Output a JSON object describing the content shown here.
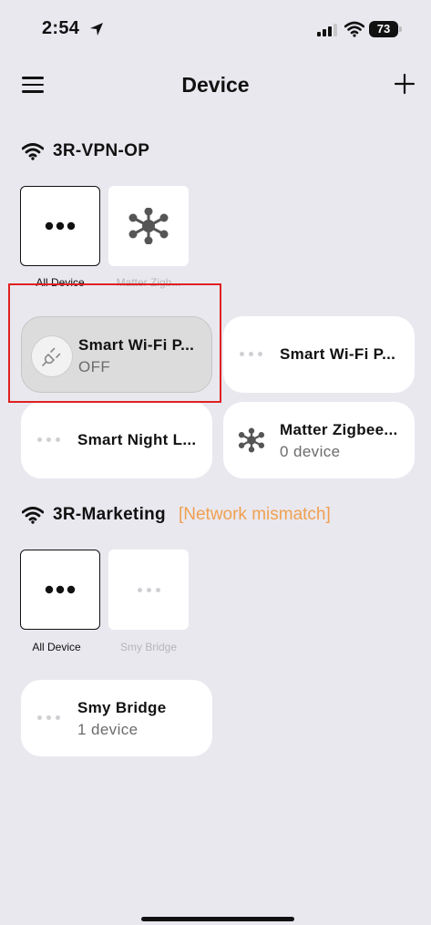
{
  "status_bar": {
    "time": "2:54",
    "battery": "73"
  },
  "nav": {
    "title": "Device"
  },
  "networks": [
    {
      "name": "3R-VPN-OP",
      "warning": "",
      "tiles": [
        {
          "label": "All Device",
          "icon": "more-dots-icon",
          "selected": true
        },
        {
          "label": "Matter Zigb...",
          "icon": "hub-icon",
          "selected": false
        }
      ],
      "devices": [
        {
          "title": "Smart Wi-Fi P...",
          "subtitle": "OFF",
          "icon": "plug-icon",
          "active": true
        },
        {
          "title": "Smart Wi-Fi P...",
          "subtitle": "",
          "icon": "faint-dots-icon",
          "active": false
        },
        {
          "title": "Smart Night L...",
          "subtitle": "",
          "icon": "faint-dots-icon",
          "active": false
        },
        {
          "title": "Matter Zigbee...",
          "subtitle": "0 device",
          "icon": "hub-icon",
          "active": false
        }
      ]
    },
    {
      "name": "3R-Marketing",
      "warning": "[Network mismatch]",
      "tiles": [
        {
          "label": "All Device",
          "icon": "more-dots-icon",
          "selected": true
        },
        {
          "label": "Smy Bridge",
          "icon": "faint-dots-icon",
          "selected": false
        }
      ],
      "devices": [
        {
          "title": "Smy Bridge",
          "subtitle": "1 device",
          "icon": "faint-dots-icon",
          "active": false
        }
      ]
    }
  ],
  "colors": {
    "background": "#e9e8ef",
    "warning": "#f0a050",
    "highlight": "#e02020"
  }
}
